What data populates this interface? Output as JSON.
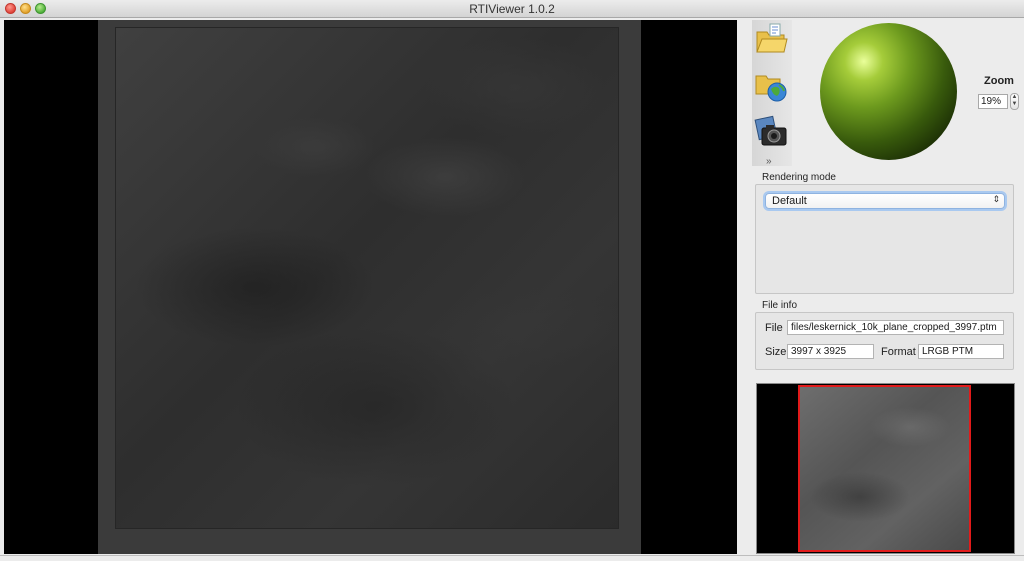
{
  "window": {
    "title": "RTIViewer 1.0.2"
  },
  "toolbar": {
    "icons": [
      "open-file-icon",
      "open-remote-icon",
      "snapshot-icon"
    ],
    "more": "»"
  },
  "zoom": {
    "label": "Zoom",
    "value": "19%"
  },
  "rendering": {
    "group_label": "Rendering mode",
    "mode": "Default"
  },
  "file_info": {
    "group_label": "File info",
    "file_label": "File",
    "file_value": "files/leskernick_10k_plane_cropped_3997.ptm",
    "size_label": "Size",
    "size_value": "3997 x 3925",
    "format_label": "Format",
    "format_value": "LRGB PTM"
  },
  "colors": {
    "sphere": "#6d9a1e",
    "navigator_frame": "#e21a1a",
    "select_focus": "#a9c9f0"
  }
}
